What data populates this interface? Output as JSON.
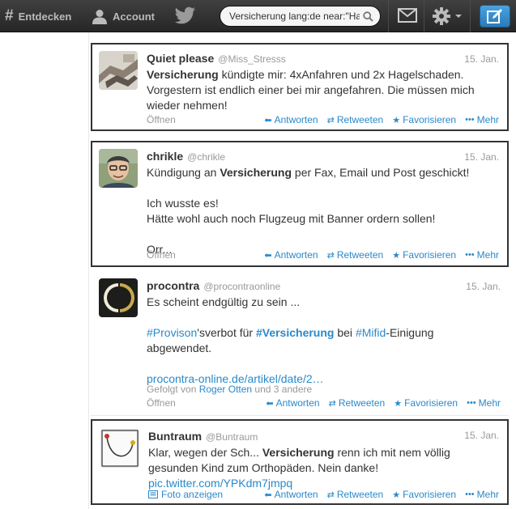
{
  "topbar": {
    "home_label": "Entdecken",
    "account_label": "Account",
    "search_value": "Versicherung lang:de near:\"Har",
    "icons": [
      "hash-icon",
      "person-icon",
      "twitter-bird-icon",
      "search-icon",
      "envelope-icon",
      "gear-icon",
      "compose-icon"
    ]
  },
  "actions": {
    "reply": "Antworten",
    "retweet": "Retweeten",
    "favorite": "Favorisieren",
    "more": "Mehr",
    "open": "Öffnen",
    "photo": "Foto anzeigen"
  },
  "highlight_colors": {
    "red": "#e05a5a",
    "yellow": "#f3dc6a",
    "orange": "#f3b04a",
    "link": "#2a89c9"
  },
  "tweets": [
    {
      "name": "Quiet please",
      "handle": "@Miss_Stresss",
      "date": "15. Jan.",
      "keyword": "Versicherung",
      "text": " kündigte mir: 4xAnfahren und 2x Hagelschaden. Vorgestern ist endlich einer bei mir angefahren. Die müssen mich wieder nehmen!"
    },
    {
      "name": "chrikle",
      "handle": "@chrikle",
      "date": "15. Jan.",
      "line1_pre": "Kündigung an ",
      "keyword": "Versicherung",
      "line1_post": " per Fax, Email und Post geschickt!",
      "line2": "Ich wusste es!",
      "line3": "Hätte wohl auch noch Flugzeug mit Banner ordern sollen!",
      "line4": "Orr..."
    },
    {
      "name": "procontra",
      "handle": "@procontraonline",
      "date": "15. Jan.",
      "line1": "Es scheint endgültig zu sein ...",
      "tag1": "#Provison",
      "mid1": "'sverbot für ",
      "tag2": "#Versicherung",
      "mid2": " bei ",
      "tag3": "#Mifid",
      "mid3": "-Einigung abgewendet.",
      "link": "procontra-online.de/artikel/date/2…",
      "followed_prefix": "Gefolgt von ",
      "followed_by": "Roger Otten",
      "followed_suffix": " und 3 andere"
    },
    {
      "name": "Buntraum",
      "handle": "@Buntraum",
      "date": "15. Jan.",
      "pre": "Klar, wegen der Sch... ",
      "keyword": "Versicherung",
      "post": " renn ich mit nem völlig gesunden Kind zum Orthopäden. Nein danke!",
      "link": "pic.twitter.com/YPKdm7jmpq"
    }
  ]
}
